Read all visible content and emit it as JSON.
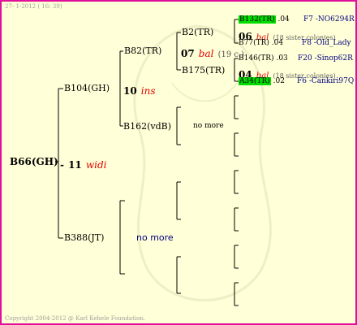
{
  "header": "27- 1-2012 ( 16: 39)",
  "footer": "Copyright 2004-2012 @ Karl Kehele Foundation.",
  "root": {
    "id": "B66(GH)",
    "dash": "-",
    "number": "11",
    "trait": "widi"
  },
  "gen1": [
    {
      "id": "B104(GH)",
      "number": "10",
      "trait": "ins"
    },
    {
      "id": "B388(JT)",
      "note": "no more"
    }
  ],
  "gen2": [
    {
      "id": "B82(TR)"
    },
    {
      "id": "B162(vdB)",
      "note": "no more"
    }
  ],
  "gen3": [
    {
      "id": "B2(TR)",
      "number": "07",
      "trait": "bal",
      "century": "(19 c.)"
    },
    {
      "id": "B175(TR)"
    }
  ],
  "gen4": [
    {
      "id": "B132(TR)",
      "year": ".04",
      "source": "F7 -NO6294R"
    },
    {
      "number": "06",
      "trait": "bal",
      "note": "(18 sister colonies)"
    },
    {
      "id": "B77(TR)",
      "year": ".04",
      "source": "F8 -Old_Lady"
    },
    {
      "id": "B146(TR)",
      "year": ".03",
      "source": "F20 -Sinop62R"
    },
    {
      "number": "04",
      "trait": "bal",
      "note": "(18 sister colonies)"
    },
    {
      "id": "A34(TR)",
      "year": ".02",
      "source": "F6 -Cankiri97Q"
    }
  ],
  "colors": {
    "background": "#ffffd8",
    "border": "#e0109a",
    "highlight": "#00dd00",
    "trait": "#e00000",
    "link": "#000080"
  }
}
